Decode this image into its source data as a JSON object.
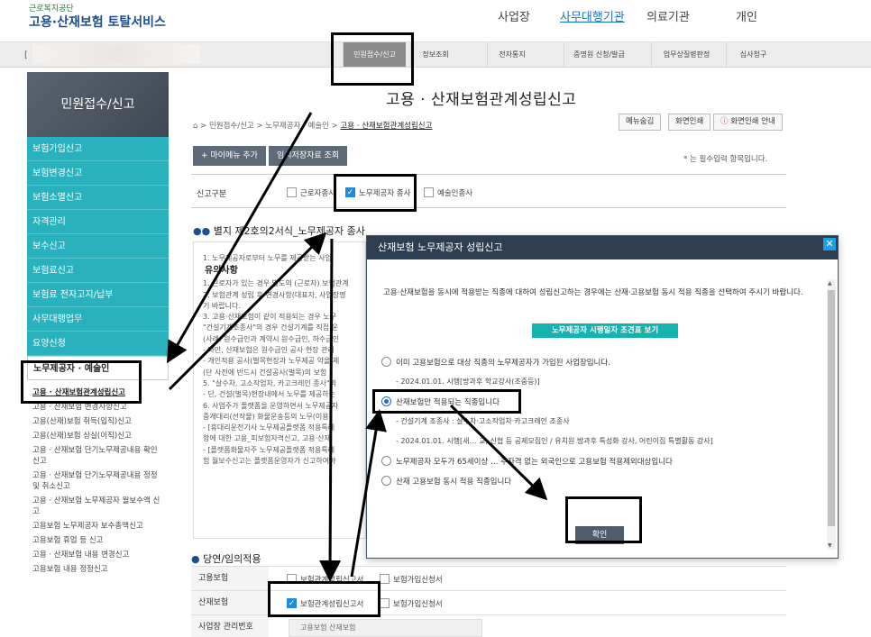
{
  "header": {
    "logo_sub": "근로복지공단",
    "logo_main": "고용·산재보험 토탈서비스",
    "nav": [
      "사업장",
      "사무대행기관",
      "의료기관",
      "개인"
    ],
    "nav_active": "사무대행기관"
  },
  "menubar": {
    "bracket": "[",
    "items": [
      "민원접수/신고",
      "정보조회",
      "전자통지",
      "증명원 신청/발급",
      "업무상질병판정",
      "심사청구"
    ]
  },
  "sidebar": {
    "title": "민원접수/신고",
    "items": [
      "보험가입신고",
      "보험변경신고",
      "보험소멸신고",
      "자격관리",
      "보수신고",
      "보험료신고",
      "보험료 전자고지/납부",
      "사무대행업무",
      "요양신청",
      "노무제공자 · 예술인"
    ],
    "sub_items": [
      "고용 · 산재보험관계성립신고",
      "고용 · 산재보험 변경사항신고",
      "고용(산재)보험 취득(입직)신고",
      "고용(산재)보험 상실(이직)신고",
      "고용 · 산재보험 단기노무제공내용 확인신고",
      "고용 · 산재보험 단기노무제공내용 정정 및 취소신고",
      "고용 · 산재보험 노무제공자 월보수액 신고",
      "고용보험 노무제공자 보수총액신고",
      "고용보험 휴업 등 신고",
      "고용 · 산재보험 내용 변경신고",
      "고용보험 내용 정정신고"
    ]
  },
  "main": {
    "title": "고용 · 산재보험관계성립신고",
    "breadcrumb": [
      "민원접수/신고",
      "노무제공자 · 예술인",
      "고용 · 산재보험관계성립신고"
    ],
    "btn_menu_hide": "메뉴숨김",
    "btn_print": "화면인쇄",
    "btn_print_guide": "화면인쇄 안내",
    "btn_add_mymenu": "+ 마이메뉴 추가",
    "btn_saved": "임시저장자료 조회",
    "required_note": "* 는 필수입력 항목입니다.",
    "report_type_label": "신고구분",
    "report_types": [
      {
        "label": "근로자종사",
        "checked": false
      },
      {
        "label": "노무제공자 종사",
        "checked": true
      },
      {
        "label": "예술인종사",
        "checked": false
      }
    ],
    "section_title": "별지 제2호의2서식_노무제공자 종사",
    "notice_lines": [
      "1. 노무제공자로부터 노무를 제공받는 사업",
      "유의사항",
      "1. 근로자가 있는 경우 별도의 (근로자) 보험관계",
      "2. 보험관계 성립 후 변경사항(대표자, 사업장명",
      "기 바랍니다.",
      "3. 고용·산재보험이 같이 적용되는 경우 노무",
      "\"건설기계조종사\"의 경우 건설기계를 직접 운",
      "(사례: 원수급인과 계약시 원수급인, 하수급인",
      "- 다만, 산재보험은 원수급인 공사 현장 관리",
      "- 개인적용 공사(벌목현장과 노무제공 약을 체",
      "(단 사전에 반드시 건설공사(벌목)의 보험",
      "5. \"살수차, 고소작업차, 카고크레인 종사\"의",
      "- 단, 건설(벌목)현장내에서 노무를 제공하는",
      "6. 사업주가 플랫폼을 운영하면서 노무제공자",
      "중개대리(선작물) 화물운송등의 노무(이용)",
      "- [휴대리운전기사 노무제공플랫폼 적용특례",
      "항에 대한 고용_피보험자격신고, 고용·산재",
      "- [플랫폼화물자주 노무제공플랫폼 적용특례",
      "험 월보수신고는 플랫폼운영자가 신고하여야"
    ],
    "apply_section": "당연/임의적용",
    "apply_rows": [
      {
        "label": "고용보험",
        "options": [
          {
            "label": "보험관계성립신고서",
            "checked": false
          },
          {
            "label": "보험가입신청서",
            "checked": false
          }
        ]
      },
      {
        "label": "산재보험",
        "options": [
          {
            "label": "보험관계성립신고서",
            "checked": true
          },
          {
            "label": "보험가입신청서",
            "checked": false
          }
        ]
      }
    ],
    "biz_no_label": "사업장 관리번호",
    "biz_no_value": "고용보험 산재보험"
  },
  "modal": {
    "title": "산재보험 노무제공자 성립신고",
    "close": "✕",
    "description": "고용·산재보험을 동시에 적용받는 직종에 대하여 성립신고하는 경우에는 산재·고용보험 동시 적용 직종을 선택하여 주시기 바랍니다.",
    "view_button": "노무제공자 시행일자 조견표 보기",
    "options": [
      {
        "label": "이미 고용보험으로 대상 직종의 노무제공자가 가입된 사업장입니다.",
        "note": "- 2024.01.01. 시행[방과후 학교강사(초중등)]",
        "selected": false
      },
      {
        "label": "산재보험만 적용되는 직종입니다",
        "note": "- 건설기계 조종사 : 살수차·고소작업차·카고크레인 조종사",
        "note2": "- 2024.01.01. 시행[새… 교, 신협 등 공제모집인 / 유치원 방과후 특성화 강사, 어린이집 특별활동 강사]",
        "selected": true
      },
      {
        "label": "노무제공자 모두가 65세이상 … 주자격 없는 외국인으로 고용보험 적용제외대상입니다",
        "selected": false
      },
      {
        "label": "산재 고용보험 동시 적용 직종입니다",
        "selected": false
      }
    ],
    "confirm": "확인",
    "scroll_up": "▲",
    "scroll_down": "▼"
  },
  "colors": {
    "sidebar_teal": "#29b2bd",
    "modal_header": "#2d3e50",
    "view_button_teal": "#16b3ae",
    "link_blue": "#1a73c7"
  },
  "icons": {
    "home": "home-icon",
    "print_guide": "info-circle-icon",
    "close": "close-icon"
  }
}
